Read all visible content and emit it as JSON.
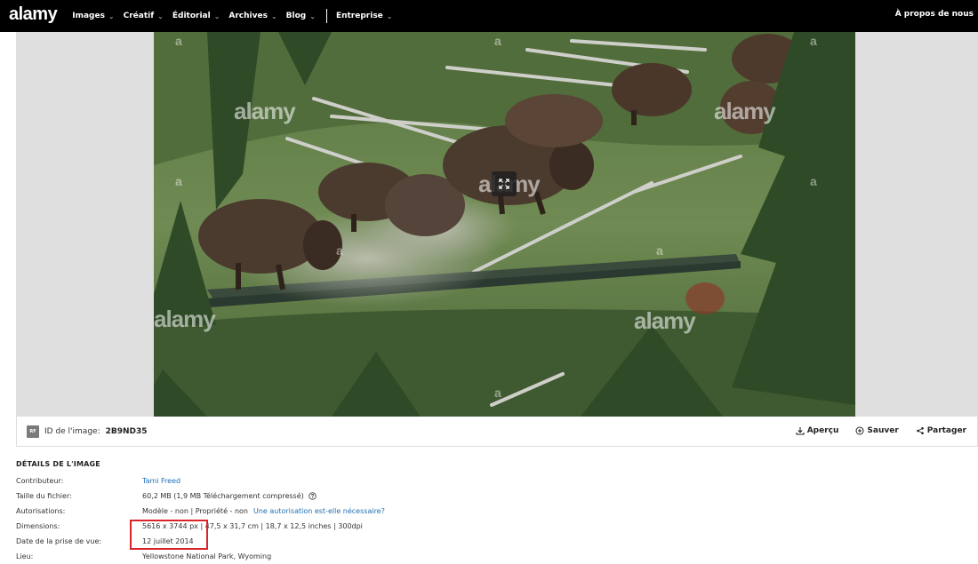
{
  "nav": {
    "logo": "alamy",
    "items": [
      {
        "label": "Images"
      },
      {
        "label": "Créatif"
      },
      {
        "label": "Éditorial"
      },
      {
        "label": "Archives"
      },
      {
        "label": "Blog"
      }
    ],
    "enterprise": "Entreprise",
    "about": "À propos de nous"
  },
  "watermark": {
    "text": "alamy",
    "mark": "a"
  },
  "id_bar": {
    "badge": "RF",
    "label": "ID de l'image:",
    "value": "2B9ND35",
    "preview": "Aperçu",
    "save": "Sauver",
    "share": "Partager"
  },
  "details": {
    "title": "DÉTAILS DE L'IMAGE",
    "contributor_label": "Contributeur:",
    "contributor_value": "Tami Freed",
    "filesize_label": "Taille du fichier:",
    "filesize_value": "60,2 MB (1,9 MB Téléchargement compressé)",
    "permissions_label": "Autorisations:",
    "permissions_value": "Modèle - non | Propriété - non",
    "permissions_link": "Une autorisation est-elle nécessaire?",
    "dimensions_label": "Dimensions:",
    "dimensions_value": "5616 x 3744 px | 47,5 x 31,7 cm | 18,7 x 12,5 inches | 300dpi",
    "date_label": "Date de la prise de vue:",
    "date_value": "12 juillet 2014",
    "location_label": "Lieu:",
    "location_value": "Yellowstone National Park, Wyoming"
  },
  "colors": {
    "topbar": "#000000",
    "link": "#1f6fb2",
    "highlight": "#d9252a"
  }
}
